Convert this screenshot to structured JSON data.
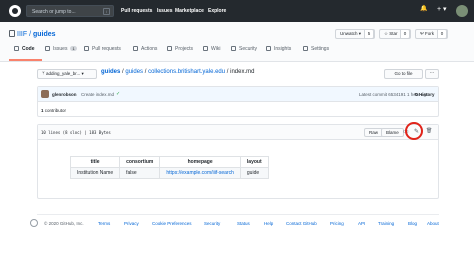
{
  "header": {
    "search_placeholder": "Search or jump to...",
    "search_shortcut": "/",
    "nav": [
      "Pull requests",
      "Issues",
      "Marketplace",
      "Explore"
    ],
    "bell": "🔔",
    "plus": "+ ▾"
  },
  "repo": {
    "owner": "IIIF",
    "separator": "/",
    "name": "guides",
    "unwatch_label": "Unwatch ▾",
    "unwatch_count": "5",
    "star_label": "☆ Star",
    "star_count": "0",
    "fork_label": "Ψ Fork",
    "fork_count": "0"
  },
  "tabs": [
    {
      "label": "Code"
    },
    {
      "label": "Issues",
      "count": "1"
    },
    {
      "label": "Pull requests"
    },
    {
      "label": "Actions"
    },
    {
      "label": "Projects"
    },
    {
      "label": "Wiki"
    },
    {
      "label": "Security"
    },
    {
      "label": "Insights"
    },
    {
      "label": "Settings"
    }
  ],
  "file_nav": {
    "branch": "ᛘ adding_yale_br... ▾",
    "crumbs": [
      "guides",
      "guides",
      "collections.britishart.yale.edu"
    ],
    "filename": "index.md",
    "go_to_file": "Go to file",
    "more": "···"
  },
  "commit": {
    "user": "glenrobson",
    "message": "Create index.md",
    "check": "✓",
    "latest": "Latest commit 6534191 1 hour ago",
    "history": "⟲ History",
    "contributors": "1",
    "contributors_text": " contributor"
  },
  "file": {
    "info": "10 lines (8 sloc)  |  183 Bytes",
    "raw": "Raw",
    "blame": "Blame",
    "icons": {
      "desktop": "▭",
      "edit": "✎",
      "delete": "🗑"
    }
  },
  "table": {
    "headers": [
      "title",
      "consortium",
      "homepage",
      "layout"
    ],
    "rows": [
      [
        "Institution Name",
        "false",
        "https://example.com/iiif-search",
        "guide"
      ]
    ]
  },
  "footer": {
    "copyright": "© 2020 GitHub, Inc.",
    "links": [
      "Terms",
      "Privacy",
      "Cookie Preferences",
      "Security",
      "Status",
      "Help",
      "Contact GitHub",
      "Pricing",
      "API",
      "Training",
      "Blog",
      "About"
    ]
  },
  "colors": {
    "topbar": "#24292e",
    "link": "#0366d6",
    "highlight": "#e0241b",
    "active_tab": "#f9826c"
  }
}
